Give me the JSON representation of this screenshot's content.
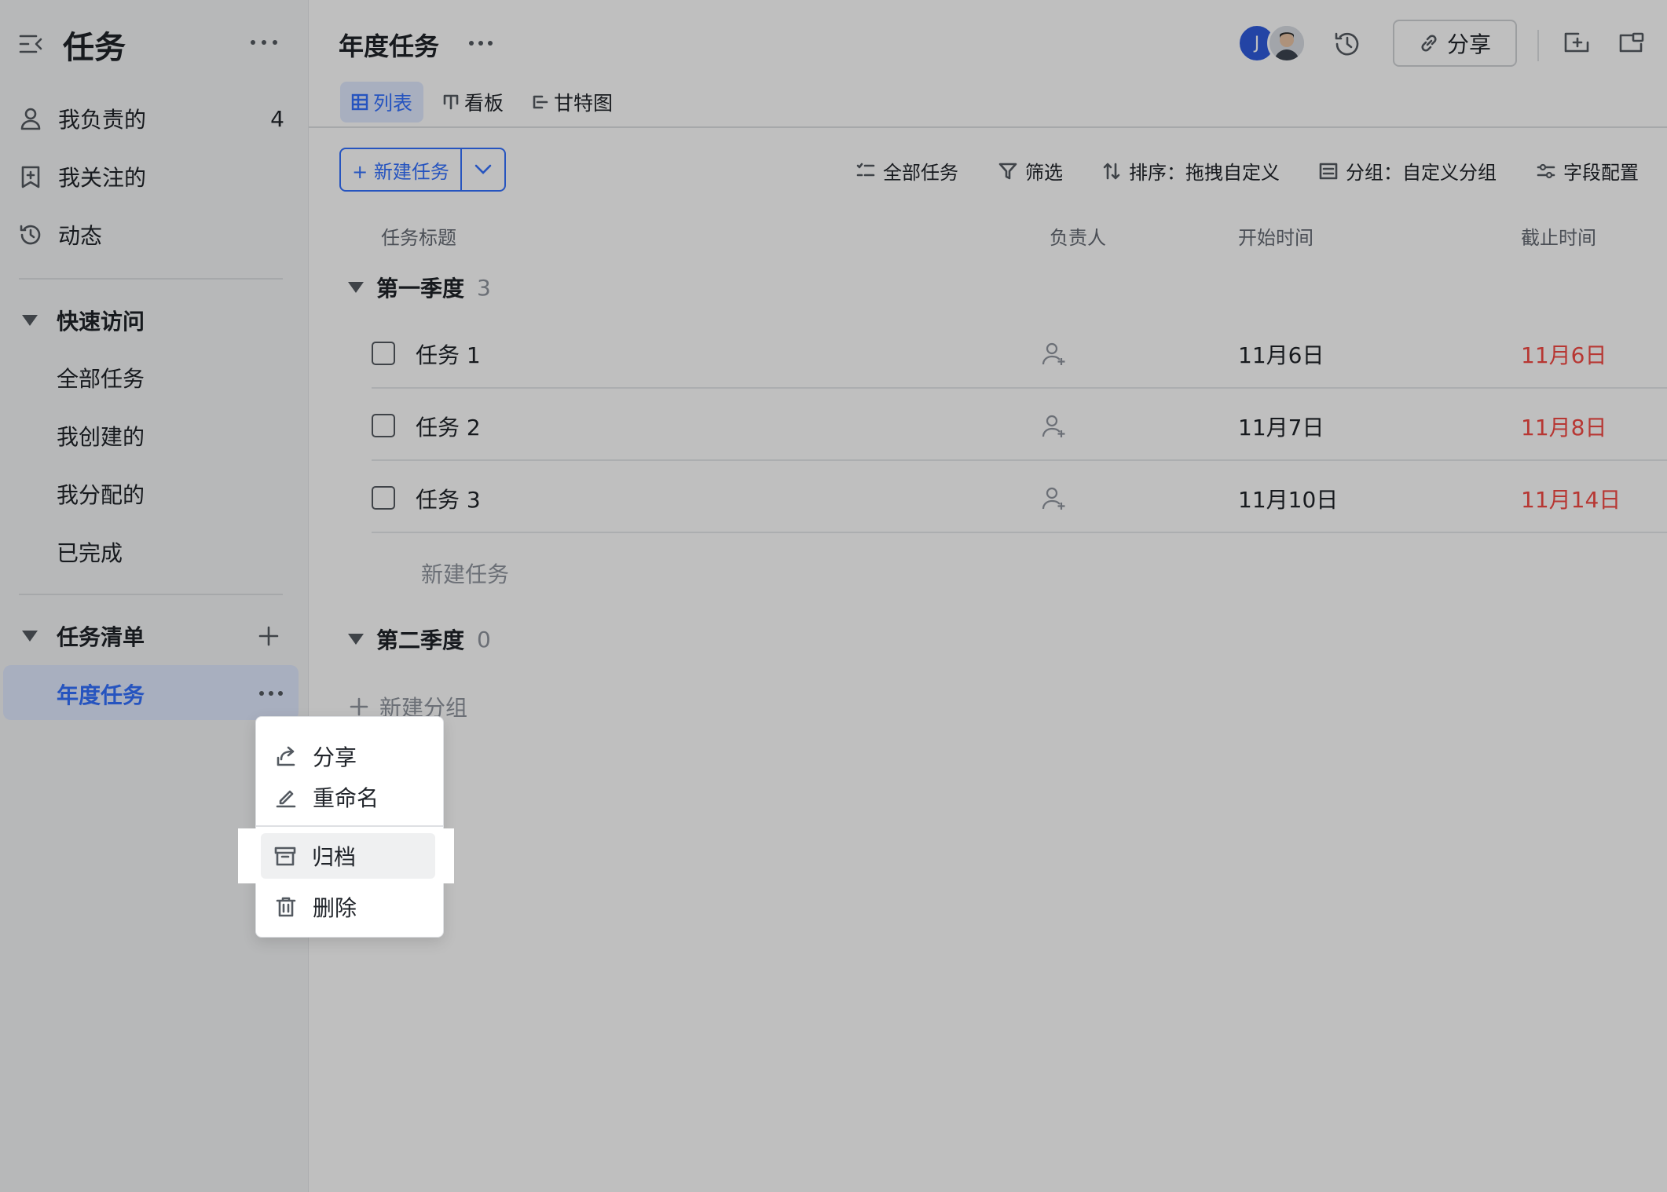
{
  "sidebar": {
    "title": "任务",
    "nav": [
      {
        "label": "我负责的",
        "count": "4",
        "icon": "person-icon"
      },
      {
        "label": "我关注的",
        "icon": "bookmark-icon"
      },
      {
        "label": "动态",
        "icon": "history-icon"
      }
    ],
    "quick_access": {
      "title": "快速访问",
      "items": [
        "全部任务",
        "我创建的",
        "我分配的",
        "已完成"
      ]
    },
    "task_lists": {
      "title": "任务清单",
      "items": [
        "年度任务"
      ]
    }
  },
  "header": {
    "title": "年度任务",
    "avatar_initial": "J",
    "share_label": "分享"
  },
  "tabs": [
    {
      "label": "列表",
      "active": true
    },
    {
      "label": "看板",
      "active": false
    },
    {
      "label": "甘特图",
      "active": false
    }
  ],
  "toolbar": {
    "new_task": "+ 新建任务",
    "all_tasks": "全部任务",
    "filter": "筛选",
    "sort": "排序：拖拽自定义",
    "group": "分组：自定义分组",
    "fields": "字段配置"
  },
  "columns": {
    "title": "任务标题",
    "assignee": "负责人",
    "start": "开始时间",
    "due": "截止时间"
  },
  "groups": [
    {
      "name": "第一季度",
      "count": "3",
      "tasks": [
        {
          "title": "任务 1",
          "start": "11月6日",
          "due": "11月6日"
        },
        {
          "title": "任务 2",
          "start": "11月7日",
          "due": "11月8日"
        },
        {
          "title": "任务 3",
          "start": "11月10日",
          "due": "11月14日"
        }
      ],
      "new_task": "新建任务"
    },
    {
      "name": "第二季度",
      "count": "0"
    }
  ],
  "new_group": "新建分组",
  "context_menu": {
    "items": [
      "分享",
      "重命名",
      "归档",
      "删除"
    ],
    "highlighted": "归档"
  },
  "colors": {
    "accent": "#3370ff",
    "overdue": "#f54a45",
    "active_bg": "#e1eaff"
  }
}
